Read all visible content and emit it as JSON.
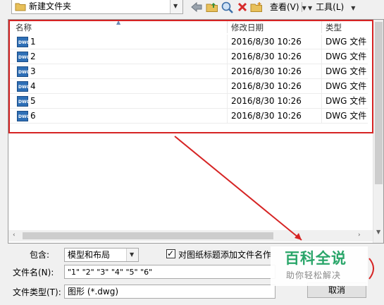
{
  "path_bar": {
    "current_folder": "新建文件夹"
  },
  "toolbar": {
    "icons": [
      "back-arrow-icon",
      "up-folder-icon",
      "search-web-icon",
      "delete-icon",
      "new-folder-icon"
    ],
    "views_label": "查看(V)",
    "tools_label": "工具(L)"
  },
  "file_list": {
    "columns": [
      "名称",
      "修改日期",
      "类型"
    ],
    "files": [
      {
        "name": "1",
        "modified": "2016/8/30 10:26",
        "type": "DWG 文件"
      },
      {
        "name": "2",
        "modified": "2016/8/30 10:26",
        "type": "DWG 文件"
      },
      {
        "name": "3",
        "modified": "2016/8/30 10:26",
        "type": "DWG 文件"
      },
      {
        "name": "4",
        "modified": "2016/8/30 10:26",
        "type": "DWG 文件"
      },
      {
        "name": "5",
        "modified": "2016/8/30 10:26",
        "type": "DWG 文件"
      },
      {
        "name": "6",
        "modified": "2016/8/30 10:26",
        "type": "DWG 文件"
      }
    ]
  },
  "form": {
    "include_label": "包含:",
    "include_value": "模型和布局",
    "title_checkbox_label": "对图纸标题添加文件名作",
    "title_checkbox_checked": true,
    "filename_label": "文件名(N):",
    "filename_value": "\"1\" \"2\" \"3\" \"4\" \"5\" \"6\"",
    "filetype_label": "文件类型(T):",
    "filetype_value": "图形 (*.dwg)",
    "cancel_label": "取消"
  },
  "watermark": {
    "title": "百科全说",
    "subtitle": "助你轻松解决"
  },
  "colors": {
    "highlight_red": "#d62424",
    "watermark_green": "#2aa66a",
    "dwg_icon_blue": "#2e6fb6"
  }
}
